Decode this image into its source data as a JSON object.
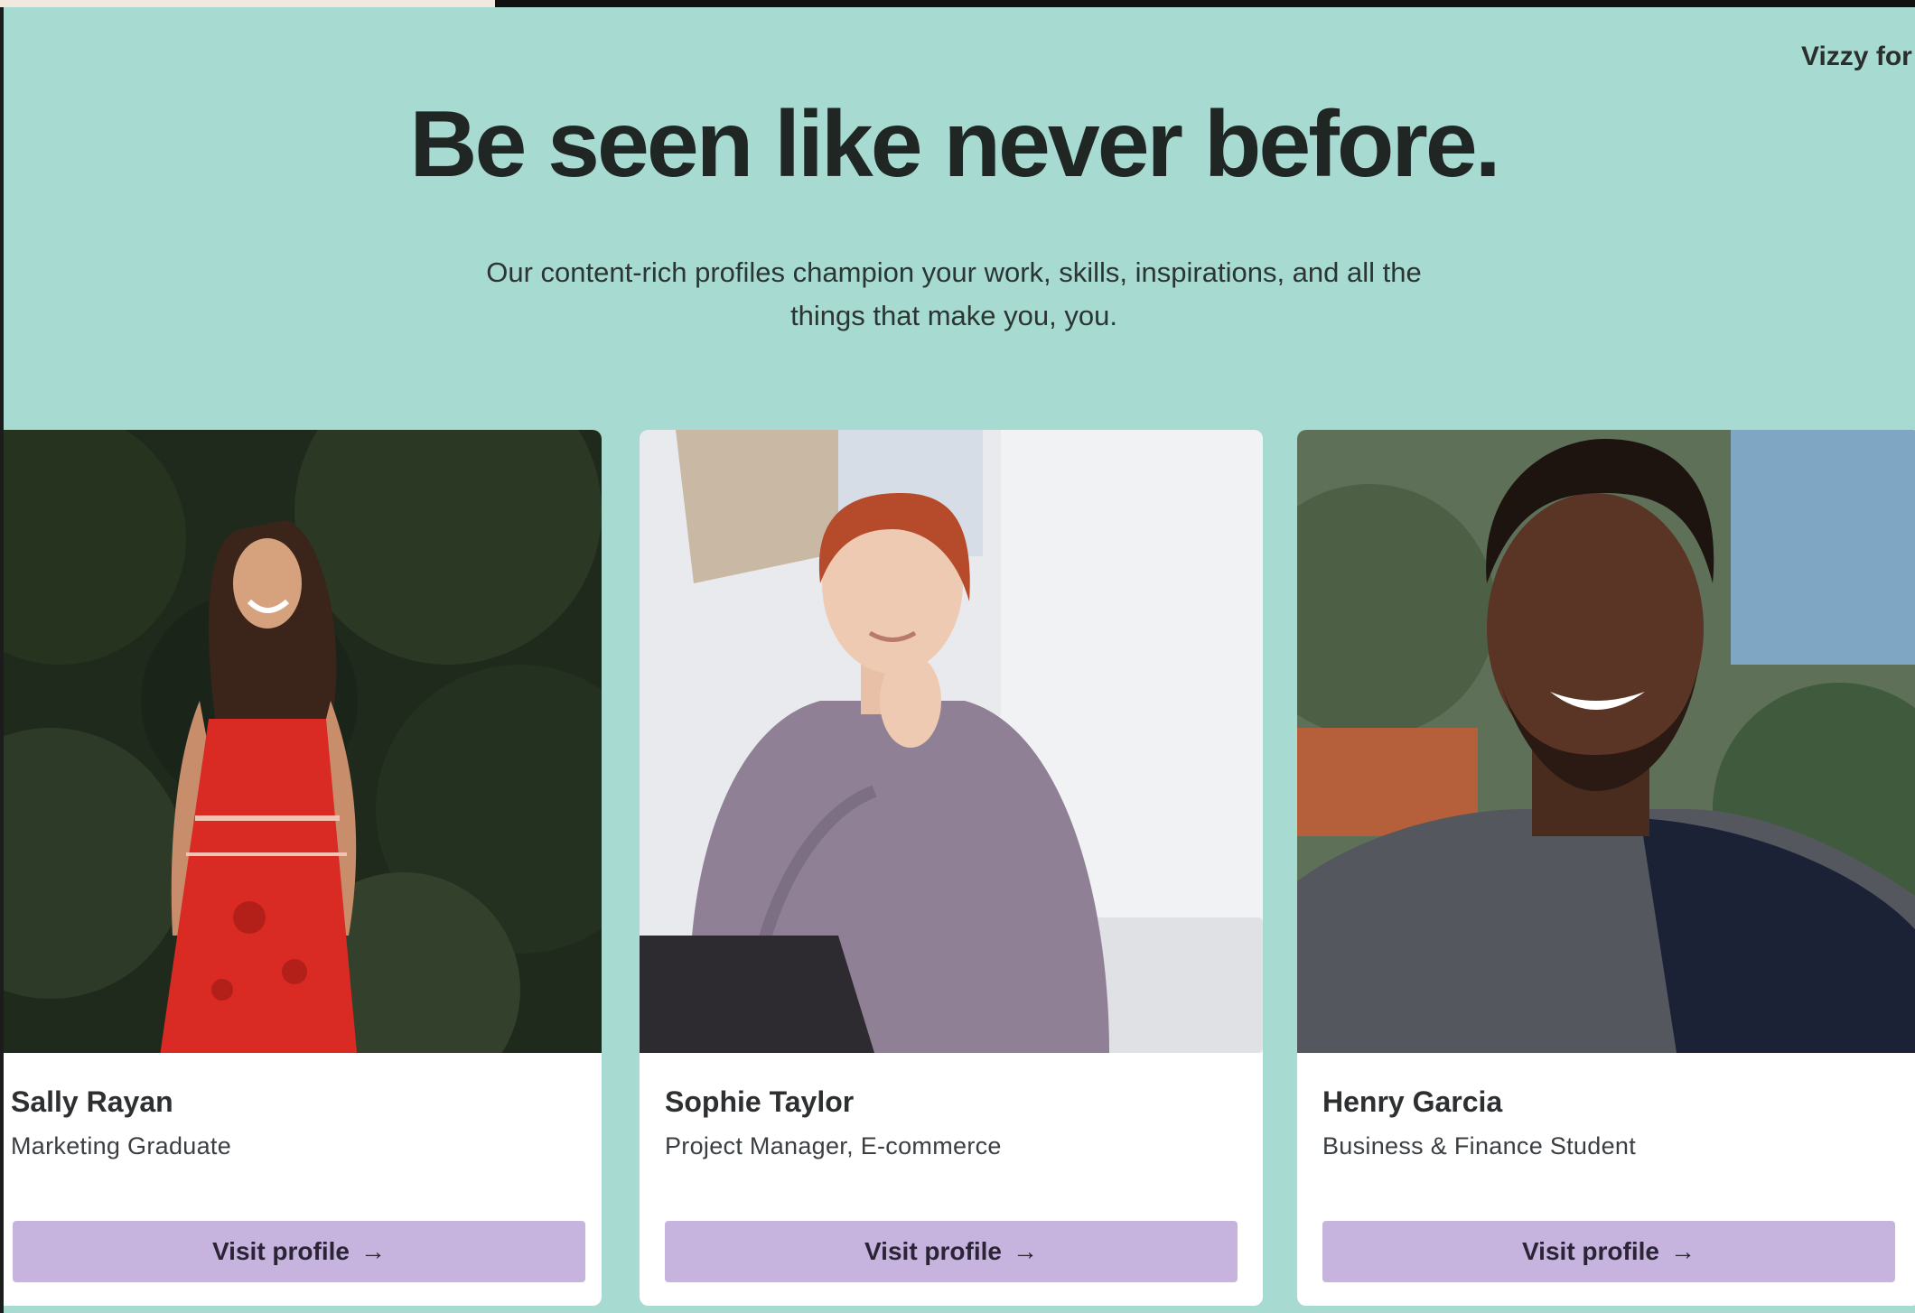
{
  "brand": {
    "label": "Vizzy for"
  },
  "hero": {
    "title": "Be seen like never before.",
    "subtitle": "Our content-rich profiles champion your work, skills, inspirations, and all the things that make you, you."
  },
  "profiles": [
    {
      "name": "Sally Rayan",
      "role": "Marketing Graduate",
      "cta": "Visit profile",
      "arrow_icon": "arrow-right-icon"
    },
    {
      "name": "Sophie Taylor",
      "role": "Project Manager, E-commerce",
      "cta": "Visit profile",
      "arrow_icon": "arrow-right-icon"
    },
    {
      "name": "Henry Garcia",
      "role": "Business & Finance Student",
      "cta": "Visit profile",
      "arrow_icon": "arrow-right-icon"
    }
  ],
  "colors": {
    "section_bg": "#a7dbd2",
    "card_bg": "#ffffff",
    "button_bg": "#c6b4df",
    "headline": "#1f2624"
  }
}
